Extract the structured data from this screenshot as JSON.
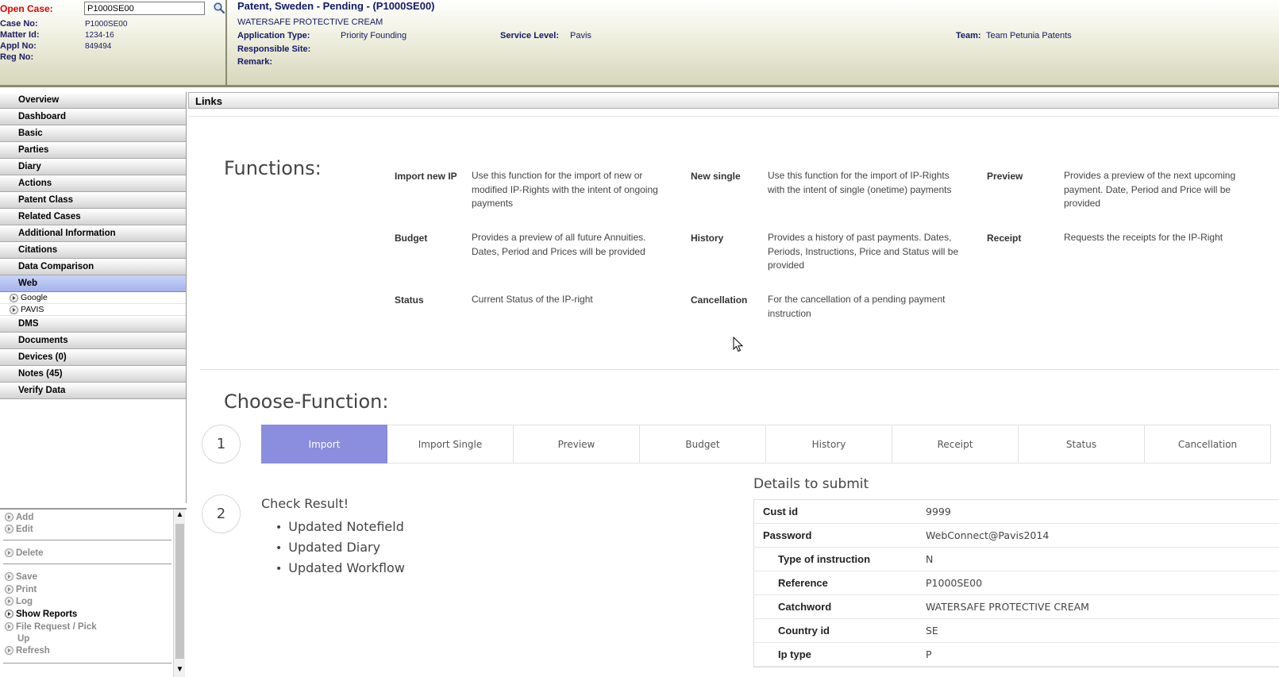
{
  "header": {
    "open_case_label": "Open Case:",
    "open_case_value": "P1000SE00",
    "fields": [
      {
        "label": "Case No:",
        "value": "P1000SE00"
      },
      {
        "label": "Matter Id:",
        "value": "1234-16"
      },
      {
        "label": "Appl No:",
        "value": "849494"
      },
      {
        "label": "Reg No:",
        "value": ""
      }
    ],
    "title": "Patent, Sweden - Pending - (P1000SE00)",
    "subtitle": "WATERSAFE PROTECTIVE CREAM",
    "application_type_label": "Application Type:",
    "application_type_value": "Priority Founding",
    "service_level_label": "Service Level:",
    "service_level_value": "Pavis",
    "team_label": "Team:",
    "team_value": "Team Petunia Patents",
    "responsible_site_label": "Responsible Site:",
    "remark_label": "Remark:"
  },
  "sidebar": {
    "items": [
      "Overview",
      "Dashboard",
      "Basic",
      "Parties",
      "Diary",
      "Actions",
      "Patent Class",
      "Related Cases",
      "Additional Information",
      "Citations",
      "Data Comparison",
      "Web"
    ],
    "web_children": [
      "Google",
      "PAVIS"
    ],
    "items_after": [
      "DMS",
      "Documents",
      "Devices (0)",
      "Notes (45)",
      "Verify Data"
    ]
  },
  "actions": {
    "add": "Add",
    "edit": "Edit",
    "delete": "Delete",
    "save": "Save",
    "print": "Print",
    "log": "Log",
    "show_reports": "Show Reports",
    "file_request_1": "File Request / Pick",
    "file_request_2": "Up",
    "refresh": "Refresh"
  },
  "main": {
    "links_title": "Links",
    "functions_title": "Functions:",
    "functions": [
      {
        "name": "Import new IP",
        "desc": [
          "Use this function for the import of new or",
          "modified IP-Rights with the intent of ongoing",
          "payments"
        ]
      },
      {
        "name": "New single",
        "desc": [
          "Use this function for the import of IP-Rights",
          "with the intent of single (onetime) payments"
        ]
      },
      {
        "name": "Preview",
        "desc": [
          "Provides a preview of the next upcoming",
          "payment. Date, Period and Price will be",
          "provided"
        ]
      },
      {
        "name": "Budget",
        "desc": [
          "Provides a preview of all future Annuities.",
          "Dates, Period and Prices will be provided"
        ]
      },
      {
        "name": "History",
        "desc": [
          "Provides a history of past payments. Dates,",
          "Periods, Instructions, Price and Status will be",
          "provided"
        ]
      },
      {
        "name": "Receipt",
        "desc": [
          "Requests the receipts for the IP-Right"
        ]
      },
      {
        "name": "Status",
        "desc": [
          "Current Status of the IP-right"
        ]
      },
      {
        "name": "Cancellation",
        "desc": [
          "For the cancellation of a pending payment",
          "instruction"
        ]
      }
    ],
    "choose_title": "Choose-Function:",
    "step1": "1",
    "step2": "2",
    "tabs": [
      "Import",
      "Import Single",
      "Preview",
      "Budget",
      "History",
      "Receipt",
      "Status",
      "Cancellation"
    ],
    "active_tab": "Import",
    "check_title": "Check Result!",
    "check_items": [
      "Updated Notefield",
      "Updated Diary",
      "Updated Workflow"
    ],
    "details_title": "Details to submit",
    "details": [
      {
        "k": "Cust id",
        "v": "9999",
        "sub": false
      },
      {
        "k": "Password",
        "v": "WebConnect@Pavis2014",
        "sub": false
      },
      {
        "k": "Type of instruction",
        "v": "N",
        "sub": true
      },
      {
        "k": "Reference",
        "v": "P1000SE00",
        "sub": true
      },
      {
        "k": "Catchword",
        "v": "WATERSAFE PROTECTIVE CREAM",
        "sub": true
      },
      {
        "k": "Country id",
        "v": "SE",
        "sub": true
      },
      {
        "k": "Ip type",
        "v": "P",
        "sub": true
      }
    ]
  },
  "colors": {
    "accent_tab": "#8b8ddf",
    "open_case_label": "#e00000",
    "header_text": "#111a66"
  }
}
